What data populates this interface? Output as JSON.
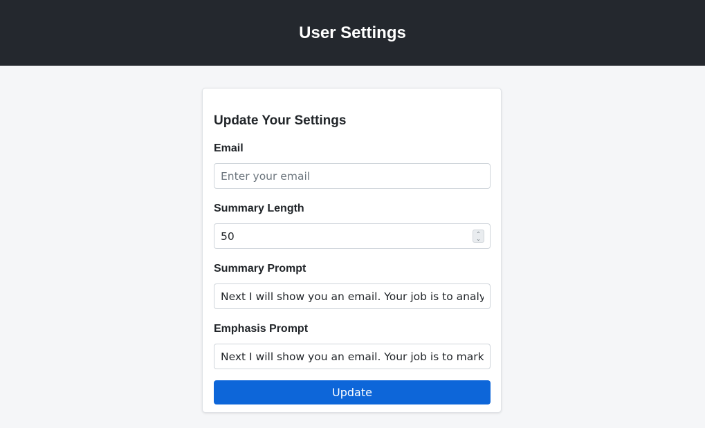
{
  "header": {
    "title": "User Settings"
  },
  "form": {
    "title": "Update Your Settings",
    "email": {
      "label": "Email",
      "value": "",
      "placeholder": "Enter your email"
    },
    "summary_length": {
      "label": "Summary Length",
      "value": "50"
    },
    "summary_prompt": {
      "label": "Summary Prompt",
      "value": "Next I will show you an email. Your job is to analyse it"
    },
    "emphasis_prompt": {
      "label": "Emphasis Prompt",
      "value": "Next I will show you an email. Your job is to mark important"
    },
    "submit_label": "Update"
  },
  "colors": {
    "header_bg": "#24282e",
    "page_bg": "#f5f6f8",
    "primary_button": "#0d66d9"
  },
  "icons": {
    "number_spinner": "spinner-up-down-icon"
  }
}
